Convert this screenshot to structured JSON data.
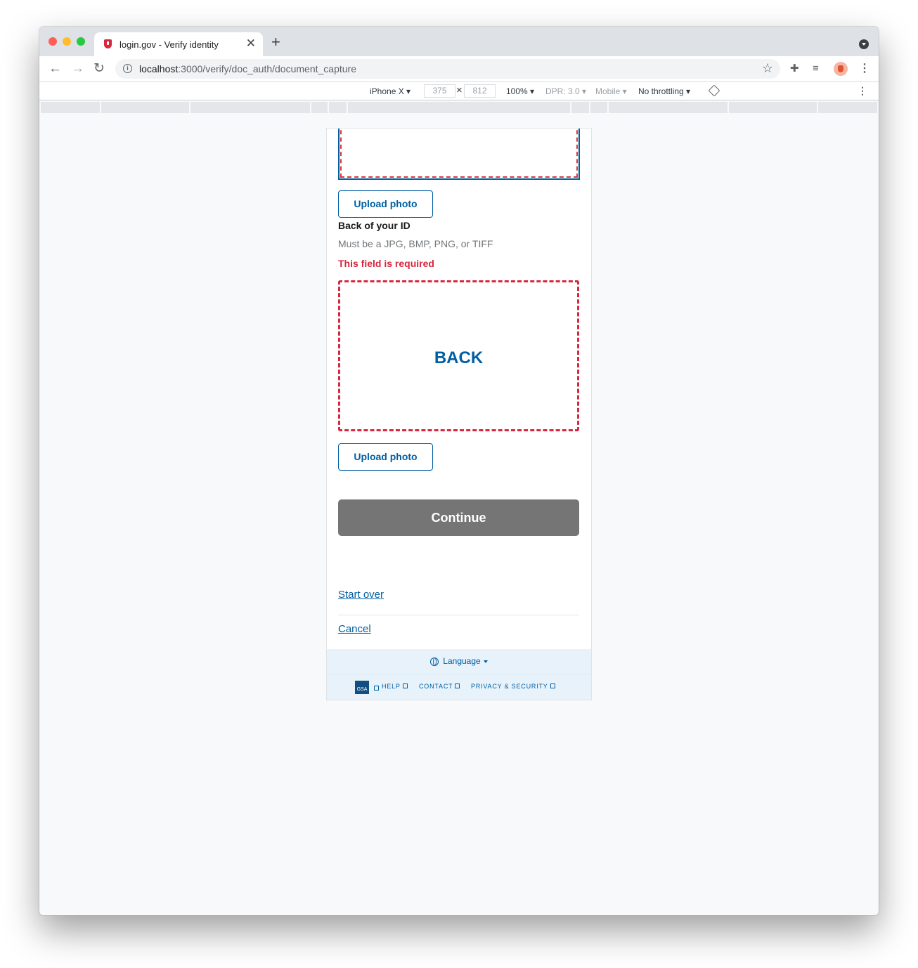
{
  "browser": {
    "tab_title": "login.gov - Verify identity",
    "tab_close": "✕",
    "new_tab": "+",
    "url_host": "localhost",
    "url_path": ":3000/verify/doc_auth/document_capture"
  },
  "devtools": {
    "device": "iPhone X ▾",
    "width": "375",
    "times": "×",
    "height": "812",
    "zoom": "100% ▾",
    "dpr": "DPR: 3.0 ▾",
    "mode": "Mobile ▾",
    "throttling": "No throttling ▾"
  },
  "page": {
    "front_upload_label": "Upload photo",
    "back_label": "Back of your ID",
    "back_hint": "Must be a JPG, BMP, PNG, or TIFF",
    "back_error": "This field is required",
    "back_placeholder": "BACK",
    "back_upload_label": "Upload photo",
    "continue_label": "Continue",
    "start_over": "Start over",
    "cancel": "Cancel"
  },
  "footer": {
    "language": "Language",
    "gsa": "GSA",
    "help": "HELP",
    "contact": "CONTACT",
    "privacy": "PRIVACY & SECURITY"
  },
  "colors": {
    "primary": "#005ea2",
    "error": "#d7263d",
    "button_disabled": "#757575"
  }
}
